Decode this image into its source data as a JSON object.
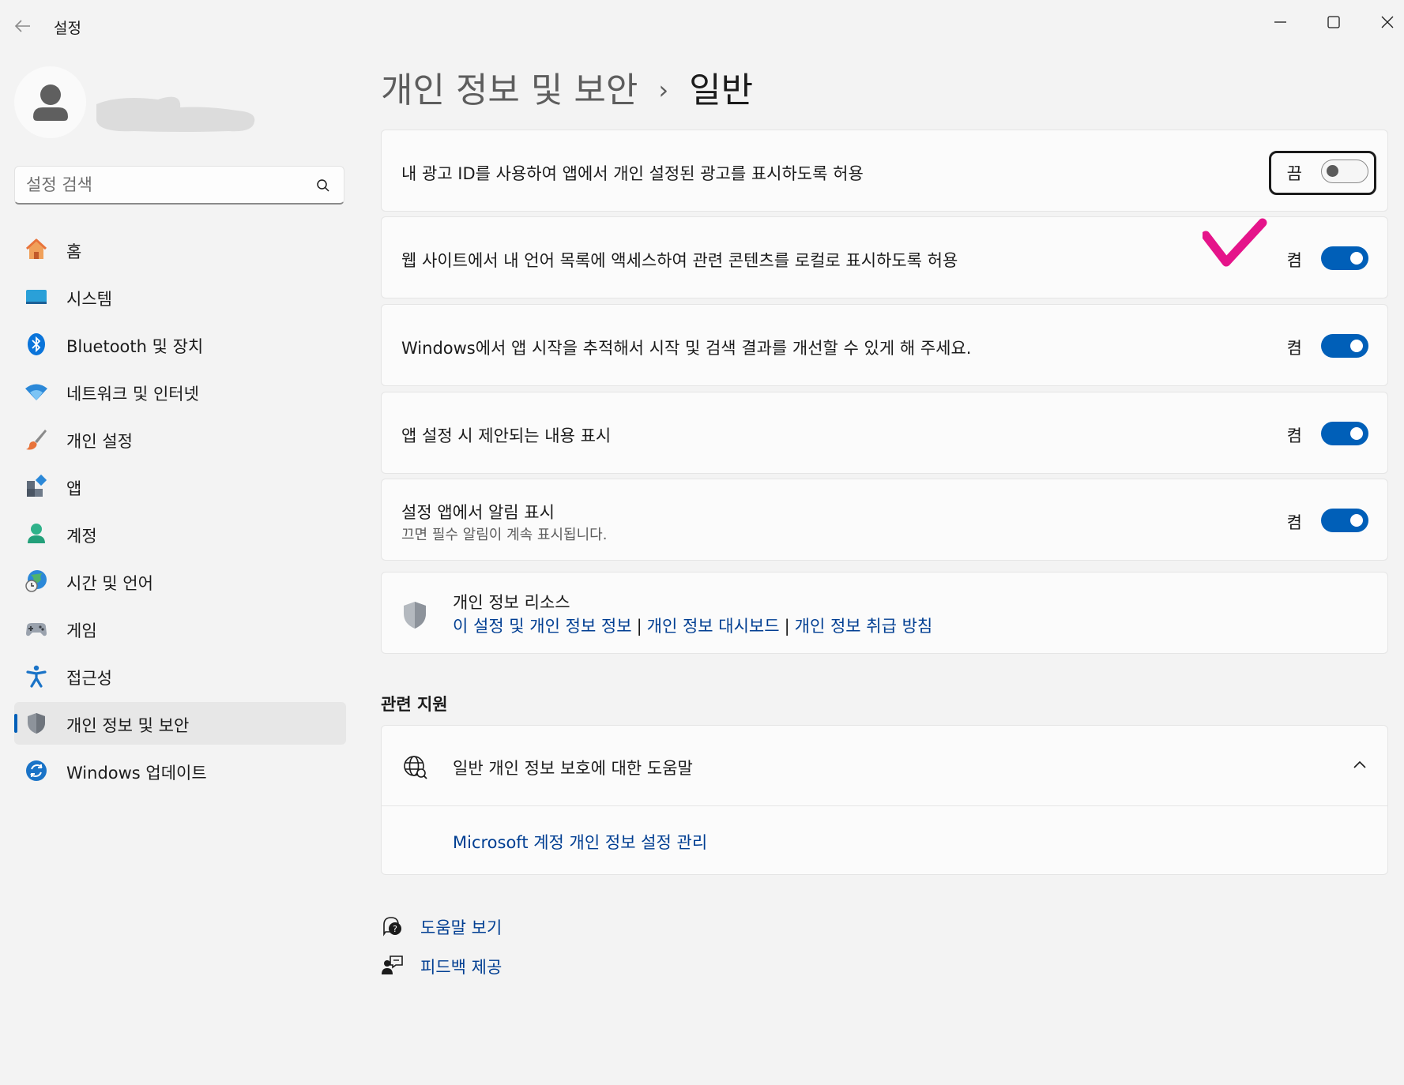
{
  "window": {
    "title": "설정"
  },
  "search": {
    "placeholder": "설정 검색"
  },
  "sidebar": {
    "items": [
      {
        "label": "홈"
      },
      {
        "label": "시스템"
      },
      {
        "label": "Bluetooth 및 장치"
      },
      {
        "label": "네트워크 및 인터넷"
      },
      {
        "label": "개인 설정"
      },
      {
        "label": "앱"
      },
      {
        "label": "계정"
      },
      {
        "label": "시간 및 언어"
      },
      {
        "label": "게임"
      },
      {
        "label": "접근성"
      },
      {
        "label": "개인 정보 및 보안",
        "selected": true
      },
      {
        "label": "Windows 업데이트"
      }
    ]
  },
  "breadcrumb": {
    "parent": "개인 정보 및 보안",
    "separator": "›",
    "current": "일반"
  },
  "settings": [
    {
      "label": "내 광고 ID를 사용하여 앱에서 개인 설정된 광고를 표시하도록 허용",
      "state": "끔",
      "on": false
    },
    {
      "label": "웹 사이트에서 내 언어 목록에 액세스하여 관련 콘텐츠를 로컬로 표시하도록 허용",
      "state": "켬",
      "on": true
    },
    {
      "label": "Windows에서 앱 시작을 추적해서 시작 및 검색 결과를 개선할 수 있게 해 주세요.",
      "state": "켬",
      "on": true
    },
    {
      "label": "앱 설정 시 제안되는 내용 표시",
      "state": "켬",
      "on": true
    },
    {
      "label": "설정 앱에서 알림 표시",
      "description": "끄면 필수 알림이 계속 표시됩니다.",
      "state": "켬",
      "on": true
    }
  ],
  "resources": {
    "title": "개인 정보 리소스",
    "links": [
      "이 설정 및 개인 정보 정보",
      "개인 정보 대시보드",
      "개인 정보 취급 방침"
    ],
    "separator": "|"
  },
  "related_support": {
    "heading": "관련 지원",
    "title": "일반 개인 정보 보호에 대한 도움말",
    "link": "Microsoft 계정 개인 정보 설정 관리"
  },
  "footer": {
    "help": "도움말 보기",
    "feedback": "피드백 제공"
  },
  "colors": {
    "accent": "#005fb8",
    "link": "#003e92",
    "annotation_check": "#e5148a"
  }
}
